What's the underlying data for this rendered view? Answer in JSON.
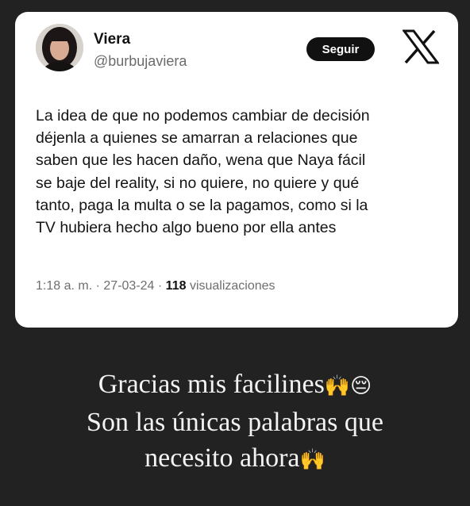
{
  "tweet": {
    "author_name": "Viera",
    "author_handle": "@burbujaviera",
    "follow_label": "Seguir",
    "text_lines": [
      "La idea de que no podemos cambiar de decisión",
      "déjenla a quienes se amarran a relaciones que",
      "saben que les hacen daño, wena que Naya fácil",
      "se baje del reality, si no quiere, no quiere y qué",
      "tanto, paga la multa o se la pagamos, como si la",
      "TV hubiera hecho algo bueno por ella antes"
    ],
    "time": "1:18 a. m.",
    "date": "27-03-24",
    "views_count": "118",
    "views_label": "visualizaciones",
    "separator": "·"
  },
  "caption": {
    "line1": "Gracias mis facilines",
    "line1_emoji": "🙌😔",
    "line2": "Son las únicas palabras que",
    "line3": "necesito ahora",
    "line3_emoji": "🙌"
  },
  "icons": {
    "logo": "x-logo-icon",
    "avatar": "profile-avatar"
  },
  "colors": {
    "background": "#232222",
    "card": "#ffffff",
    "follow_button": "#111111",
    "secondary_text": "#6e6e6e"
  }
}
